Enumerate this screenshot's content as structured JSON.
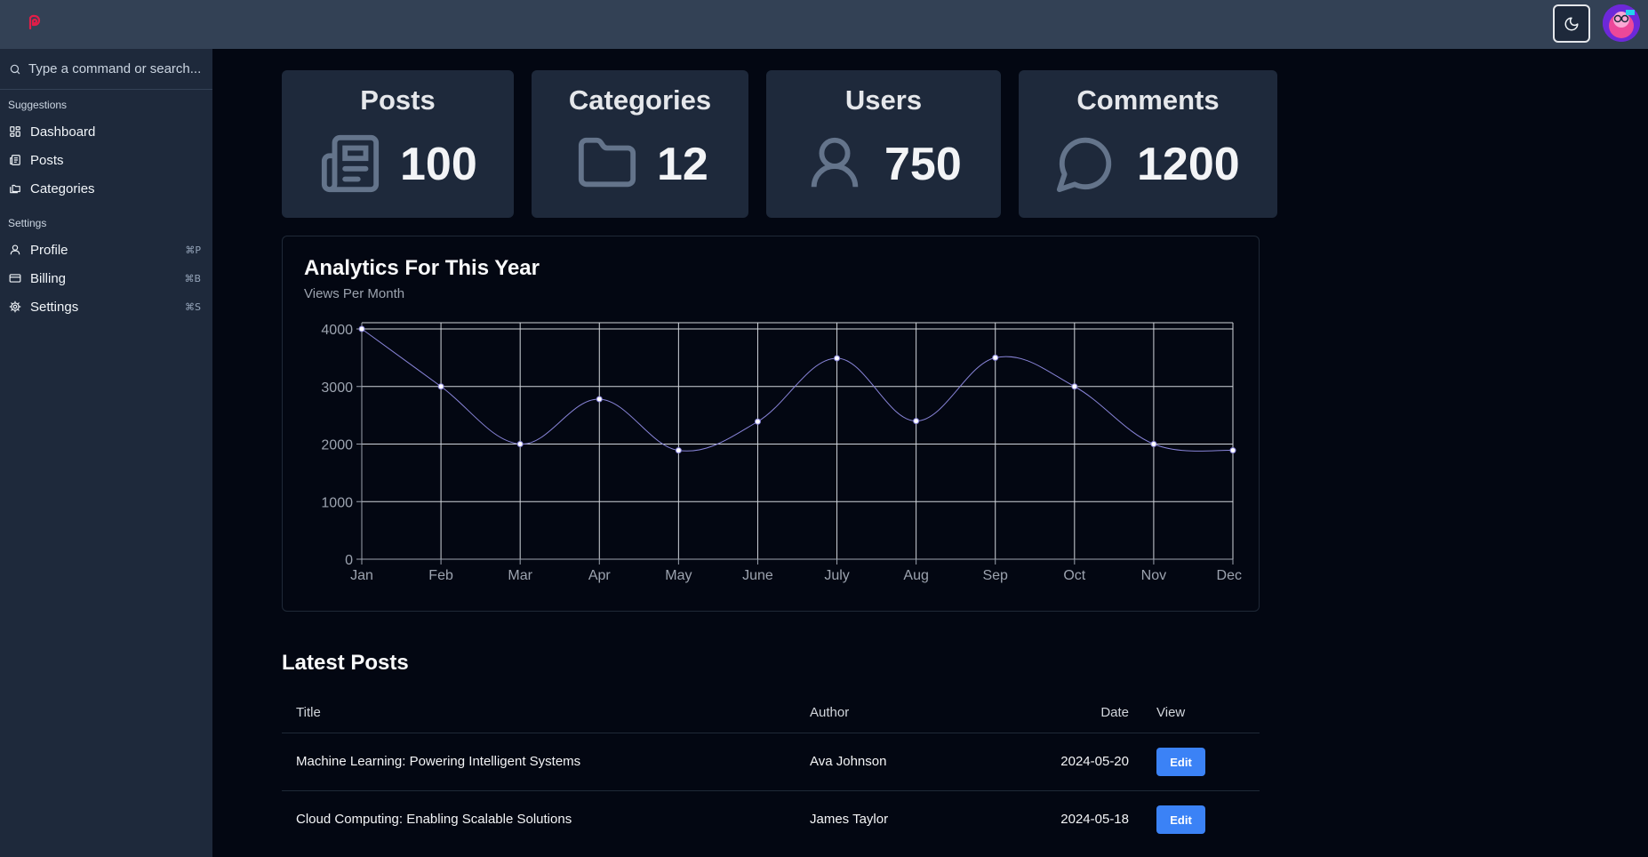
{
  "header": {
    "logo_icon": "brand-logo-icon",
    "theme_toggle_icon": "moon-icon",
    "avatar_icon": "user-avatar"
  },
  "sidebar": {
    "search": {
      "placeholder": "Type a command or search..."
    },
    "groups": [
      {
        "label": "Suggestions",
        "items": [
          {
            "label": "Dashboard",
            "icon": "dashboard-icon"
          },
          {
            "label": "Posts",
            "icon": "newspaper-icon"
          },
          {
            "label": "Categories",
            "icon": "folders-icon"
          }
        ]
      },
      {
        "label": "Settings",
        "items": [
          {
            "label": "Profile",
            "icon": "user-icon",
            "shortcut": "⌘P"
          },
          {
            "label": "Billing",
            "icon": "credit-card-icon",
            "shortcut": "⌘B"
          },
          {
            "label": "Settings",
            "icon": "gear-icon",
            "shortcut": "⌘S"
          }
        ]
      }
    ]
  },
  "stats": [
    {
      "title": "Posts",
      "value": "100",
      "icon": "newspaper-icon"
    },
    {
      "title": "Categories",
      "value": "12",
      "icon": "folder-icon"
    },
    {
      "title": "Users",
      "value": "750",
      "icon": "user-icon"
    },
    {
      "title": "Comments",
      "value": "1200",
      "icon": "message-circle-icon"
    }
  ],
  "analytics": {
    "title": "Analytics For This Year",
    "subtitle": "Views Per Month"
  },
  "chart_data": {
    "type": "line",
    "title": "Analytics For This Year",
    "subtitle": "Views Per Month",
    "categories": [
      "Jan",
      "Feb",
      "Mar",
      "Apr",
      "May",
      "June",
      "July",
      "Aug",
      "Sep",
      "Oct",
      "Nov",
      "Dec"
    ],
    "values": [
      4000,
      3000,
      2000,
      2780,
      1890,
      2390,
      3490,
      2400,
      3500,
      3000,
      2000,
      1890
    ],
    "ylim": [
      0,
      4000
    ],
    "yticks": [
      0,
      1000,
      2000,
      3000,
      4000
    ],
    "grid": true,
    "line_color": "#8884d8"
  },
  "latest_posts": {
    "title": "Latest Posts",
    "columns": [
      "Title",
      "Author",
      "Date",
      "View"
    ],
    "rows": [
      {
        "title": "Machine Learning: Powering Intelligent Systems",
        "author": "Ava Johnson",
        "date": "2024-05-20",
        "action": "Edit"
      },
      {
        "title": "Cloud Computing: Enabling Scalable Solutions",
        "author": "James Taylor",
        "date": "2024-05-18",
        "action": "Edit"
      }
    ]
  }
}
